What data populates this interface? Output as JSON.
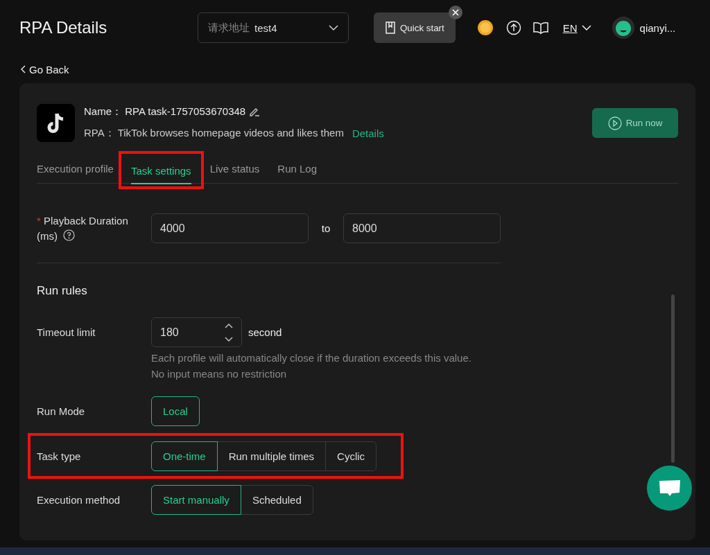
{
  "header": {
    "title": "RPA Details",
    "address": {
      "label": "请求地址",
      "value": "test4"
    },
    "quick_start": "Quick start",
    "language": "EN",
    "username": "qianyi..."
  },
  "go_back": "Go Back",
  "task": {
    "name_label": "Name：",
    "name": "RPA task-1757053670348",
    "rpa_label": "RPA：",
    "rpa": "TikTok browses homepage videos and likes them",
    "details_link": "Details",
    "run_now": {
      "label": "Run now",
      "disabled": true
    }
  },
  "tabs": [
    {
      "label": "Execution profile",
      "selected": false,
      "highlighted": false
    },
    {
      "label": "Task settings",
      "selected": true,
      "highlighted": true
    },
    {
      "label": "Live status",
      "selected": false,
      "highlighted": false
    },
    {
      "label": "Run Log",
      "selected": false,
      "highlighted": false
    }
  ],
  "playback": {
    "label": "Playback Duration (ms)",
    "required_mark": "*",
    "min": "4000",
    "separator": "to",
    "max": "8000"
  },
  "section_title": "Run rules",
  "timeout": {
    "label": "Timeout limit",
    "value": "180",
    "unit": "second",
    "help": "Each profile will automatically close if the duration exceeds this value. No input means no restriction"
  },
  "options": [
    {
      "label": "Run Mode",
      "highlighted": false,
      "choices": [
        {
          "label": "Local",
          "selected": true
        }
      ]
    },
    {
      "label": "Task type",
      "highlighted": true,
      "choices": [
        {
          "label": "One-time",
          "selected": true
        },
        {
          "label": "Run multiple times",
          "selected": false
        },
        {
          "label": "Cyclic",
          "selected": false
        }
      ]
    },
    {
      "label": "Execution method",
      "highlighted": false,
      "choices": [
        {
          "label": "Start manually",
          "selected": true
        },
        {
          "label": "Scheduled",
          "selected": false
        }
      ]
    }
  ]
}
